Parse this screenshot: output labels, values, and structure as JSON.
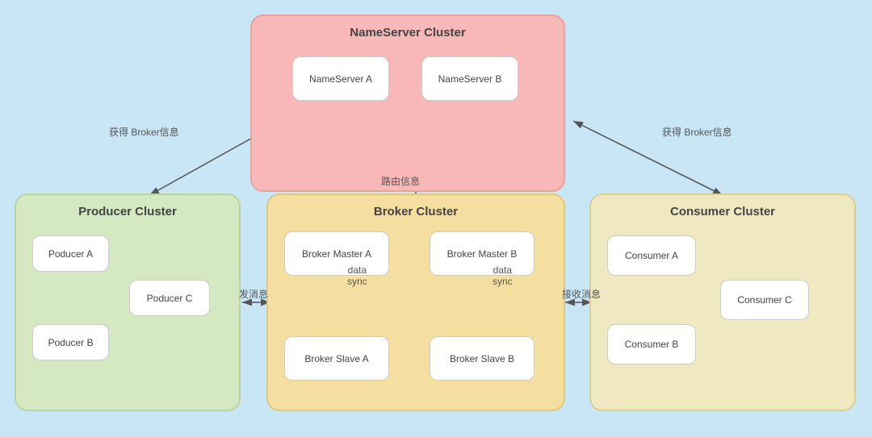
{
  "nameserver_cluster": {
    "title": "NameServer Cluster",
    "node_a": "NameServer A",
    "node_b": "NameServer B"
  },
  "producer_cluster": {
    "title": "Producer Cluster",
    "node_a": "Poducer A",
    "node_b": "Poducer B",
    "node_c": "Poducer C"
  },
  "broker_cluster": {
    "title": "Broker Cluster",
    "master_a": "Broker Master A",
    "master_b": "Broker Master B",
    "slave_a": "Broker Slave A",
    "slave_b": "Broker Slave B",
    "sync_left": "data\nsync",
    "sync_right": "data\nsync"
  },
  "consumer_cluster": {
    "title": "Consumer Cluster",
    "node_a": "Consumer A",
    "node_b": "Consumer  B",
    "node_c": "Consumer C"
  },
  "labels": {
    "get_broker_left": "获得 Broker信息",
    "get_broker_right": "获得 Broker信息",
    "route_info": "路由信息",
    "send_msg": "发消息",
    "receive_msg": "接收消息",
    "data_sync_left": "data\nsync",
    "data_sync_right": "data\nsync"
  }
}
